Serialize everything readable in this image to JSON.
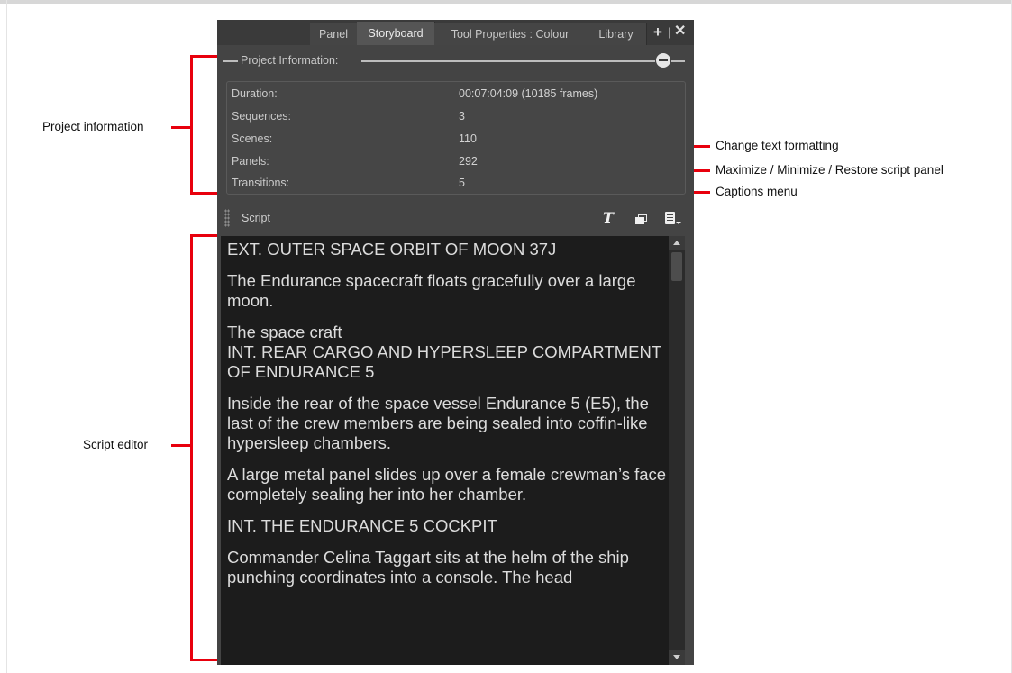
{
  "tabs": [
    {
      "label": "Panel",
      "active": false
    },
    {
      "label": "Storyboard",
      "active": true
    },
    {
      "label": "Tool Properties : Colour",
      "active": false
    },
    {
      "label": "Library",
      "active": false
    }
  ],
  "tab_controls": {
    "add_icon": "plus-icon",
    "close_icon": "close-icon"
  },
  "project_info": {
    "title": "Project Information:",
    "rows": [
      {
        "label": "Duration:",
        "value": "00:07:04:09   (10185 frames)"
      },
      {
        "label": "Sequences:",
        "value": "3"
      },
      {
        "label": "Scenes:",
        "value": "110"
      },
      {
        "label": "Panels:",
        "value": "292"
      },
      {
        "label": "Transitions:",
        "value": "5"
      }
    ]
  },
  "script": {
    "title": "Script",
    "paragraphs": [
      "EXT. OUTER SPACE ORBIT OF MOON 37J",
      "The Endurance spacecraft floats gracefully over a large moon.",
      "The space craft\nINT. REAR CARGO AND HYPERSLEEP COMPARTMENT OF ENDURANCE 5",
      "Inside the rear of the space vessel Endurance 5 (E5), the last of the crew members are being sealed into coffin-like hypersleep chambers.",
      "A large metal panel slides up over a female crewman’s face completely sealing her into her chamber.",
      "INT. THE ENDURANCE 5 COCKPIT",
      "Commander Celina Taggart sits at the helm of the ship punching coordinates into a console. The head"
    ]
  },
  "annotations": {
    "project_information": "Project information",
    "script_editor": "Script editor",
    "change_text_formatting": "Change text formatting",
    "maximize_restore": "Maximize / Minimize / Restore script panel",
    "captions_menu": "Captions menu"
  },
  "colors": {
    "annotation": "#e8000d",
    "panel_bg": "#444444",
    "editor_bg": "#1c1c1c"
  }
}
